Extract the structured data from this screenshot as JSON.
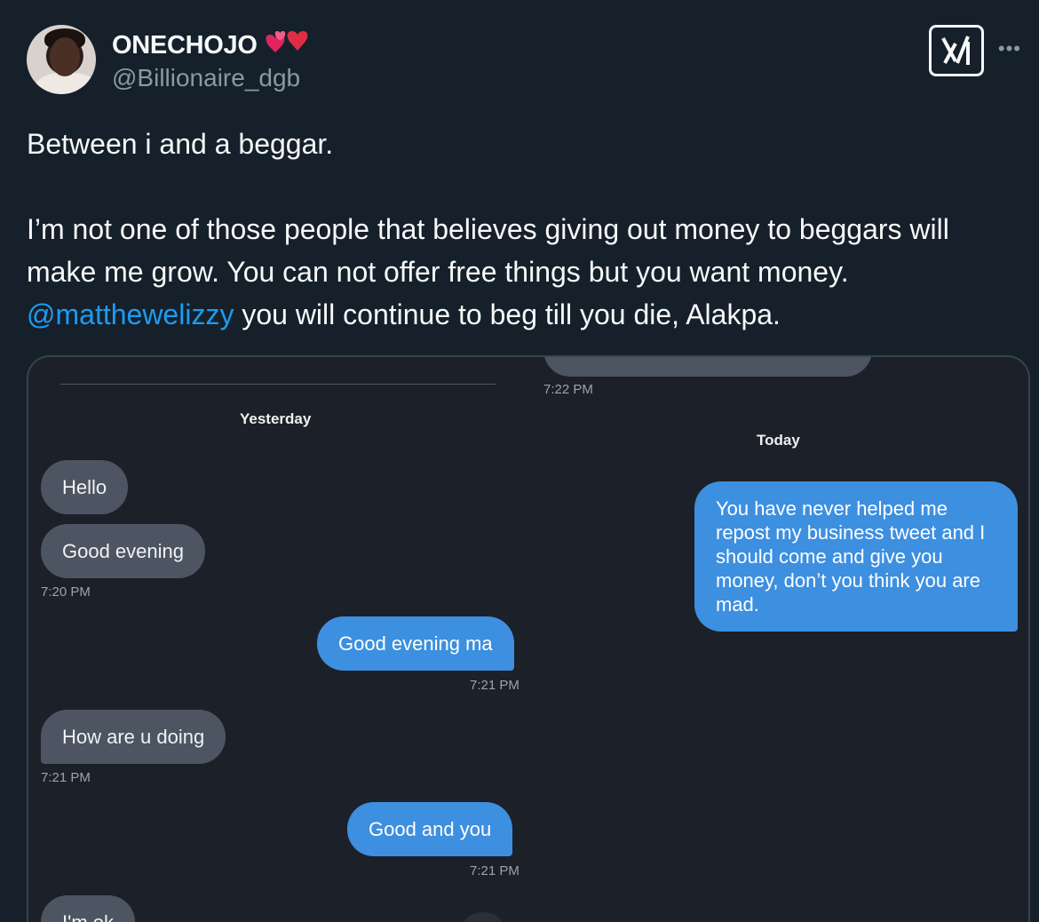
{
  "tweet": {
    "display_name": "ONECHOJO",
    "name_emojis": "💕❤️",
    "handle": "@Billionaire_dgb",
    "text_line1": "Between i and a beggar.",
    "text_para2": "I’m not one of those people that believes giving out money to beggars will make me grow. You can not offer free things but you want money.",
    "mention": "@matthewelizzy",
    "text_after_mention": " you will continue to beg till you die, Alakpa.",
    "grok_icon": "grok-icon",
    "more_icon": "more-icon",
    "more_glyph": "•••"
  },
  "chat_left": {
    "date_label": "Yesterday",
    "messages": [
      {
        "dir": "in",
        "text": "Hello"
      },
      {
        "dir": "in",
        "text": "Good evening",
        "time": "7:20 PM"
      },
      {
        "dir": "out",
        "text": "Good evening ma",
        "time": "7:21 PM"
      },
      {
        "dir": "in",
        "text": "How are u doing",
        "time": "7:21 PM"
      },
      {
        "dir": "out",
        "text": "Good and you",
        "time": "7:21 PM"
      },
      {
        "dir": "in",
        "text": "I'm ok"
      }
    ]
  },
  "chat_right": {
    "top_time": "7:22 PM",
    "date_label": "Today",
    "messages": [
      {
        "dir": "out",
        "text": "You have never helped me repost my business tweet and I should come and give you money, don’t you think you are mad."
      }
    ]
  },
  "colors": {
    "background": "#15202b",
    "mention": "#1d9bf0",
    "incoming_bubble": "#4c5561",
    "outgoing_bubble": "#3d8fe0"
  }
}
